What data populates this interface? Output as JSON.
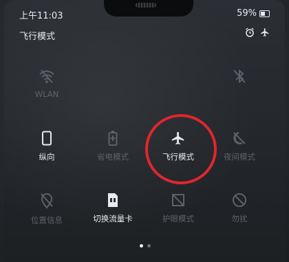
{
  "status_bar": {
    "time": "上午11:03",
    "battery": "59%"
  },
  "header": {
    "title": "飞行模式"
  },
  "tiles": {
    "wlan": {
      "label": "WLAN",
      "icon": "wifi-off-icon"
    },
    "orientation": {
      "label": "纵向",
      "icon": "phone-portrait-icon"
    },
    "power_saving": {
      "label": "省电模式",
      "icon": "battery-saver-icon"
    },
    "airplane": {
      "label": "飞行模式",
      "icon": "airplane-icon"
    },
    "night_mode": {
      "label": "夜间模式",
      "icon": "moon-off-icon"
    },
    "location": {
      "label": "位置信息",
      "icon": "location-off-icon"
    },
    "data_card": {
      "label": "切换流量卡",
      "icon": "sim-card-icon"
    },
    "eye_comfort": {
      "label": "护眼模式",
      "icon": "eye-comfort-icon"
    },
    "dnd": {
      "label": "勿扰",
      "icon": "do-not-disturb-icon"
    }
  },
  "highlight_color": "#e0262e",
  "accent_color": "#e9ecef",
  "dim_color": "#5d6268"
}
